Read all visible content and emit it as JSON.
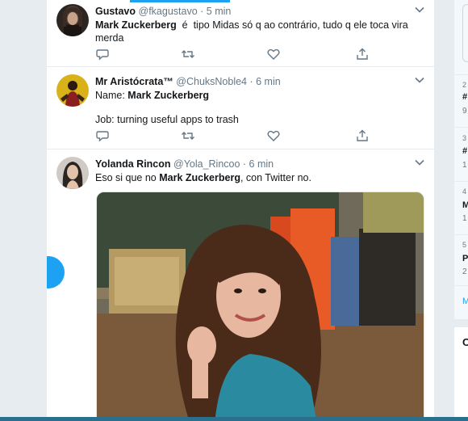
{
  "tweets": [
    {
      "name": "Gustavo",
      "handle": "@fkagustavo",
      "time": "· 5 min",
      "text_bold": "Mark Zuckerberg",
      "text_rest": "  é  tipo Midas só q ao contrário, tudo q ele toca vira merda"
    },
    {
      "name": "Mr Aristócrata™",
      "handle": "@ChuksNoble4",
      "time": "· 6 min",
      "line1_prefix": "Name: ",
      "line1_bold": "Mark Zuckerberg",
      "line2": "Job: turning useful apps to trash"
    },
    {
      "name": "Yolanda Rincon",
      "handle": "@Yola_Rincoo",
      "time": "· 6 min",
      "text_prefix": "Eso si que no ",
      "text_bold": "Mark Zuckerberg",
      "text_rest": ", con Twitter no."
    }
  ],
  "sidebar_right": {
    "items": [
      {
        "num": "2",
        "title": "#",
        "sub": "9"
      },
      {
        "num": "3",
        "title": "#",
        "sub": "1"
      },
      {
        "num": "4",
        "title": "M",
        "sub": "1"
      },
      {
        "num": "5",
        "title": "P",
        "sub": "2"
      }
    ],
    "more": "M",
    "bottom": "C"
  },
  "icons": {
    "reply": "reply-icon",
    "retweet": "retweet-icon",
    "like": "heart-icon",
    "share": "share-icon",
    "caret": "chevron-down-icon"
  },
  "colors": {
    "accent": "#1da1f2",
    "icon_gray": "#657786",
    "background": "#e6ecf0"
  }
}
